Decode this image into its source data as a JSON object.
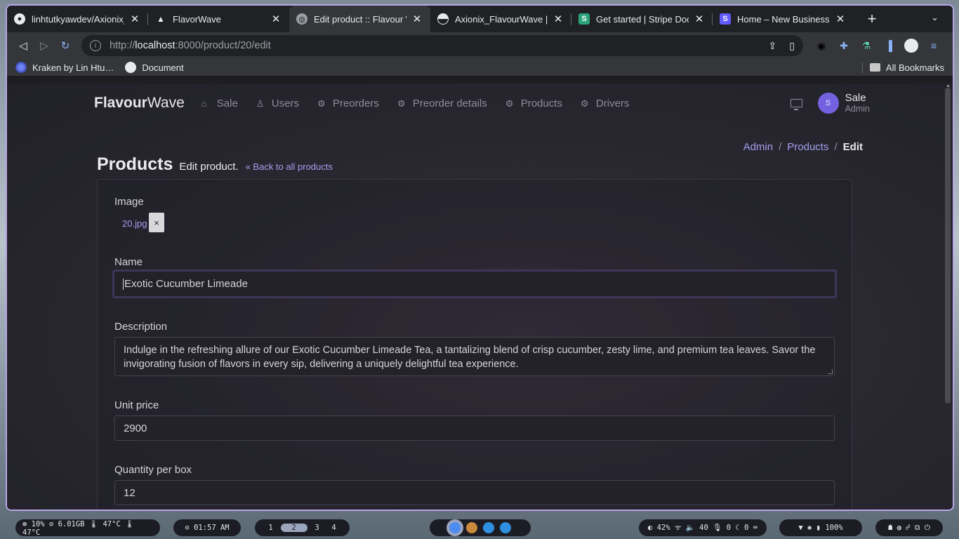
{
  "browser": {
    "tabs": [
      {
        "title": "linhtutkyawdev/Axionix_",
        "icon": "github-icon",
        "active": false
      },
      {
        "title": "FlavorWave",
        "icon": "triangle-icon",
        "active": false
      },
      {
        "title": "Edit product :: Flavour W",
        "icon": "globe-icon",
        "active": true
      },
      {
        "title": "Axionix_FlavourWave |",
        "icon": "half-circle-icon",
        "active": false
      },
      {
        "title": "Get started | Stripe Doc",
        "icon": "stripe-s-icon",
        "active": false
      },
      {
        "title": "Home – New Business",
        "icon": "stripe-s-icon",
        "active": false
      }
    ],
    "url_scheme": "http://",
    "url_host": "localhost",
    "url_rest": ":8000/product/20/edit",
    "bookmarks": [
      {
        "label": "Kraken by Lin Htu…"
      },
      {
        "label": "Document"
      }
    ],
    "all_bookmarks": "All Bookmarks"
  },
  "app": {
    "brand_bold": "Flavour",
    "brand_light": "Wave",
    "nav": [
      {
        "label": "Sale",
        "icon": "home-icon"
      },
      {
        "label": "Users",
        "icon": "user-icon"
      },
      {
        "label": "Preorders",
        "icon": "gear-icon"
      },
      {
        "label": "Preorder details",
        "icon": "gear-icon"
      },
      {
        "label": "Products",
        "icon": "gear-icon"
      },
      {
        "label": "Drivers",
        "icon": "gear-icon"
      }
    ],
    "user": {
      "initial": "S",
      "name": "Sale",
      "role": "Admin"
    },
    "breadcrumb": {
      "root": "Admin",
      "section": "Products",
      "current": "Edit",
      "sep": "/"
    },
    "page_title": "Products",
    "page_subtitle": "Edit product.",
    "back_link": "Back to all products"
  },
  "form": {
    "image_label": "Image",
    "image_file": "20.jpg",
    "remove_symbol": "×",
    "name_label": "Name",
    "name_value": "Exotic Cucumber Limeade",
    "description_label": "Description",
    "description_value": "Indulge in the refreshing allure of our Exotic Cucumber Limeade Tea, a tantalizing blend of crisp cucumber, zesty lime, and premium tea leaves. Savor the invigorating fusion of flavors in every sip, delivering a uniquely delightful tea experience.",
    "unit_price_label": "Unit price",
    "unit_price_value": "2900",
    "qty_label": "Quantity per box",
    "qty_value": "12"
  },
  "taskbar": {
    "stats": "⊛ 10%  ⊘ 6.01GB  🌡 47°C  🌡 47°C",
    "clock": "⊙ 01:57 AM",
    "workspaces": [
      "1",
      "2",
      "3",
      "4"
    ],
    "active_workspace": "2",
    "audio": "◐ 42%   ᯤ   🔈 40  🎙 0  ☾ 0  ⌨",
    "battery": "▼   ✱   ▮ 100%",
    "power": "☗  ◍  ☍  ⧉  ⏻"
  }
}
